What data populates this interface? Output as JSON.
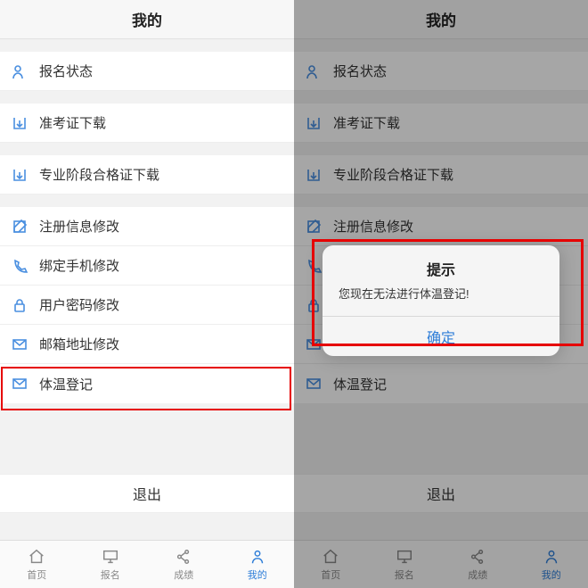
{
  "header": {
    "title": "我的"
  },
  "menu": {
    "items": [
      {
        "key": "signup-status",
        "label": "报名状态",
        "icon": "user-icon"
      },
      {
        "key": "ticket-download",
        "label": "准考证下载",
        "icon": "download-icon"
      },
      {
        "key": "cert-download",
        "label": "专业阶段合格证下载",
        "icon": "download-icon"
      },
      {
        "key": "edit-reg",
        "label": "注册信息修改",
        "icon": "edit-icon"
      },
      {
        "key": "edit-phone",
        "label": "绑定手机修改",
        "icon": "phone-icon"
      },
      {
        "key": "edit-pwd",
        "label": "用户密码修改",
        "icon": "lock-icon"
      },
      {
        "key": "edit-email",
        "label": "邮箱地址修改",
        "icon": "mail-icon"
      },
      {
        "key": "temp-reg",
        "label": "体温登记",
        "icon": "mail-icon"
      }
    ]
  },
  "logout": {
    "label": "退出"
  },
  "tabs": {
    "items": [
      {
        "key": "home",
        "label": "首页",
        "icon": "home-icon"
      },
      {
        "key": "signup",
        "label": "报名",
        "icon": "monitor-icon"
      },
      {
        "key": "score",
        "label": "成绩",
        "icon": "share-icon"
      },
      {
        "key": "mine",
        "label": "我的",
        "icon": "person-icon",
        "active": true
      }
    ]
  },
  "alert": {
    "title": "提示",
    "message": "您现在无法进行体温登记!",
    "ok": "确定"
  }
}
